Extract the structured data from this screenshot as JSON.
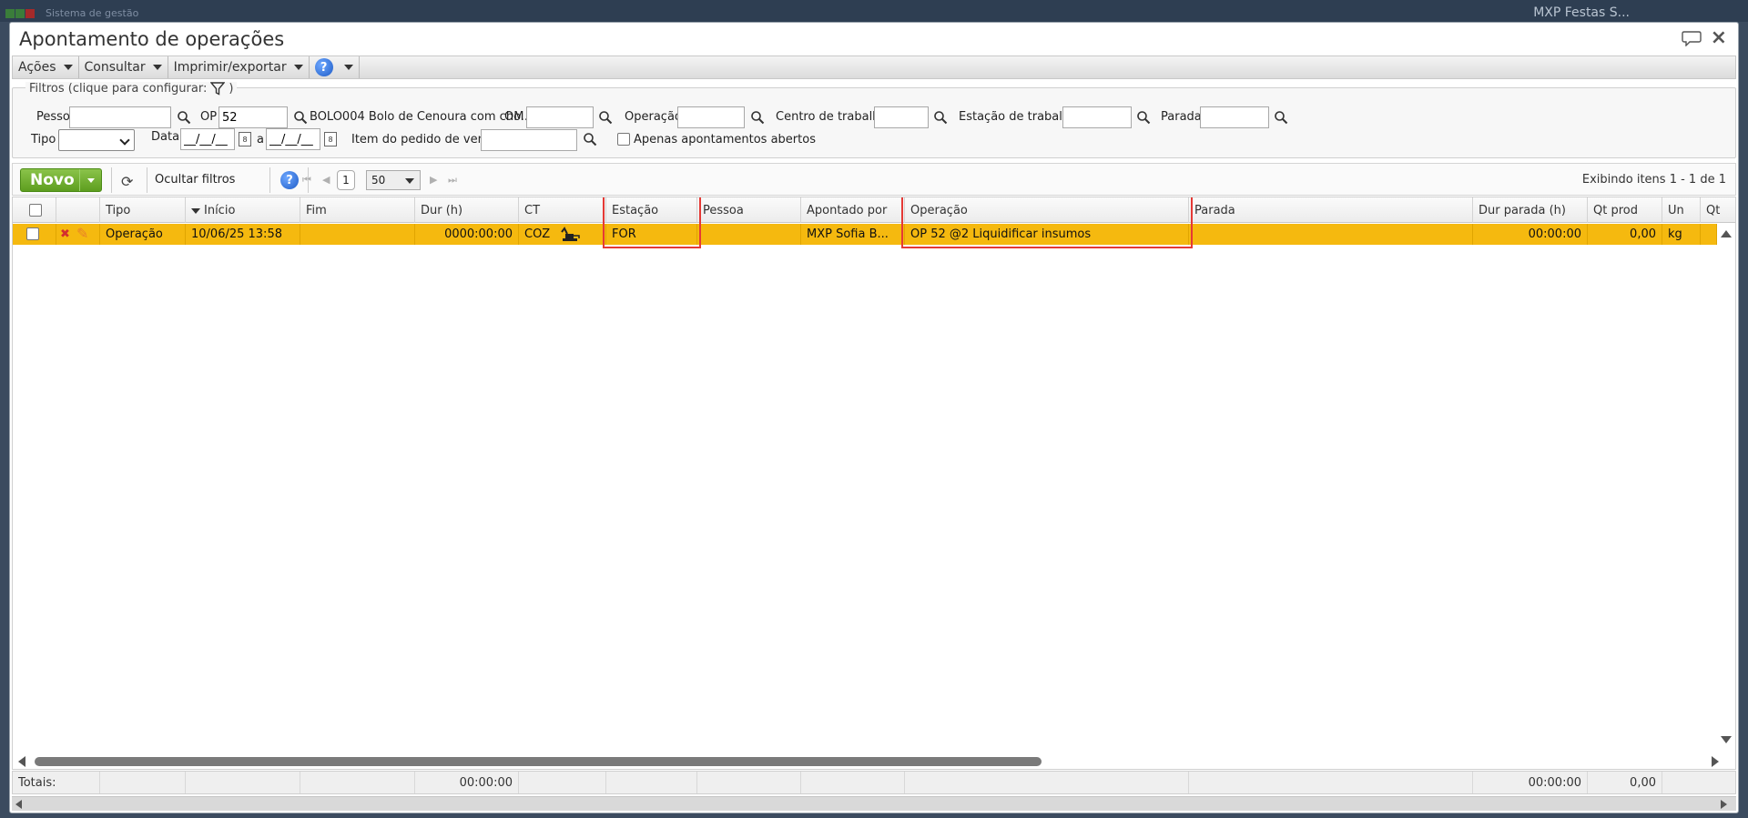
{
  "background": {
    "app_title": "Sistema de gestão",
    "company": "MXP Festas S..."
  },
  "window": {
    "title": "Apontamento de operações"
  },
  "menubar": {
    "actions": "Ações",
    "consult": "Consultar",
    "print_export": "Imprimir/exportar",
    "help": "?"
  },
  "filters": {
    "legend": "Filtros (clique para configurar:",
    "legend_end": ")",
    "pessoa_label": "Pessoa",
    "pessoa_value": "",
    "op_label": "OP",
    "op_value": "52",
    "op_desc": "BOLO004 Bolo de Cenoura com cho...",
    "om_label": "OM",
    "om_value": "",
    "operacao_label": "Operação",
    "operacao_value": "",
    "centro_label": "Centro de trabalho",
    "centro_value": "",
    "estacao_label": "Estação de trabalho",
    "estacao_value": "",
    "parada_label": "Parada",
    "parada_value": "",
    "tipo_label": "Tipo",
    "tipo_value": "",
    "data_label": "Data",
    "data_from": "__/__/__",
    "data_sep": "a",
    "data_to": "__/__/__",
    "item_label": "Item do pedido de venda",
    "item_value": "",
    "open_only_label": "Apenas apontamentos abertos",
    "open_only_checked": false
  },
  "toolbar": {
    "new_label": "Novo",
    "hide_filters": "Ocultar filtros",
    "help": "?",
    "page": "1",
    "page_size": "50",
    "showing": "Exibindo itens 1 - 1 de 1"
  },
  "grid": {
    "columns": [
      "",
      "",
      "Tipo",
      "Início",
      "Fim",
      "Dur (h)",
      "CT",
      "Estação",
      "Pessoa",
      "Apontado por",
      "Operação",
      "Parada",
      "Dur parada (h)",
      "Qt prod",
      "Un",
      "Qt"
    ],
    "rows": [
      {
        "tipo": "Operação",
        "inicio": "10/06/25 13:58",
        "fim": "",
        "dur": "0000:00:00",
        "ct": "COZ",
        "estacao": "FOR",
        "pessoa": "",
        "apontado_por": "MXP Sofia B...",
        "operacao": "OP 52 @2 Liquidificar insumos",
        "parada": "",
        "dur_parada": "00:00:00",
        "qt_prod": "0,00",
        "un": "kg"
      }
    ],
    "row_color": "#f5b90f"
  },
  "totals": {
    "label": "Totais:",
    "dur": "00:00:00",
    "dur_parada": "00:00:00",
    "qt_prod": "0,00"
  }
}
